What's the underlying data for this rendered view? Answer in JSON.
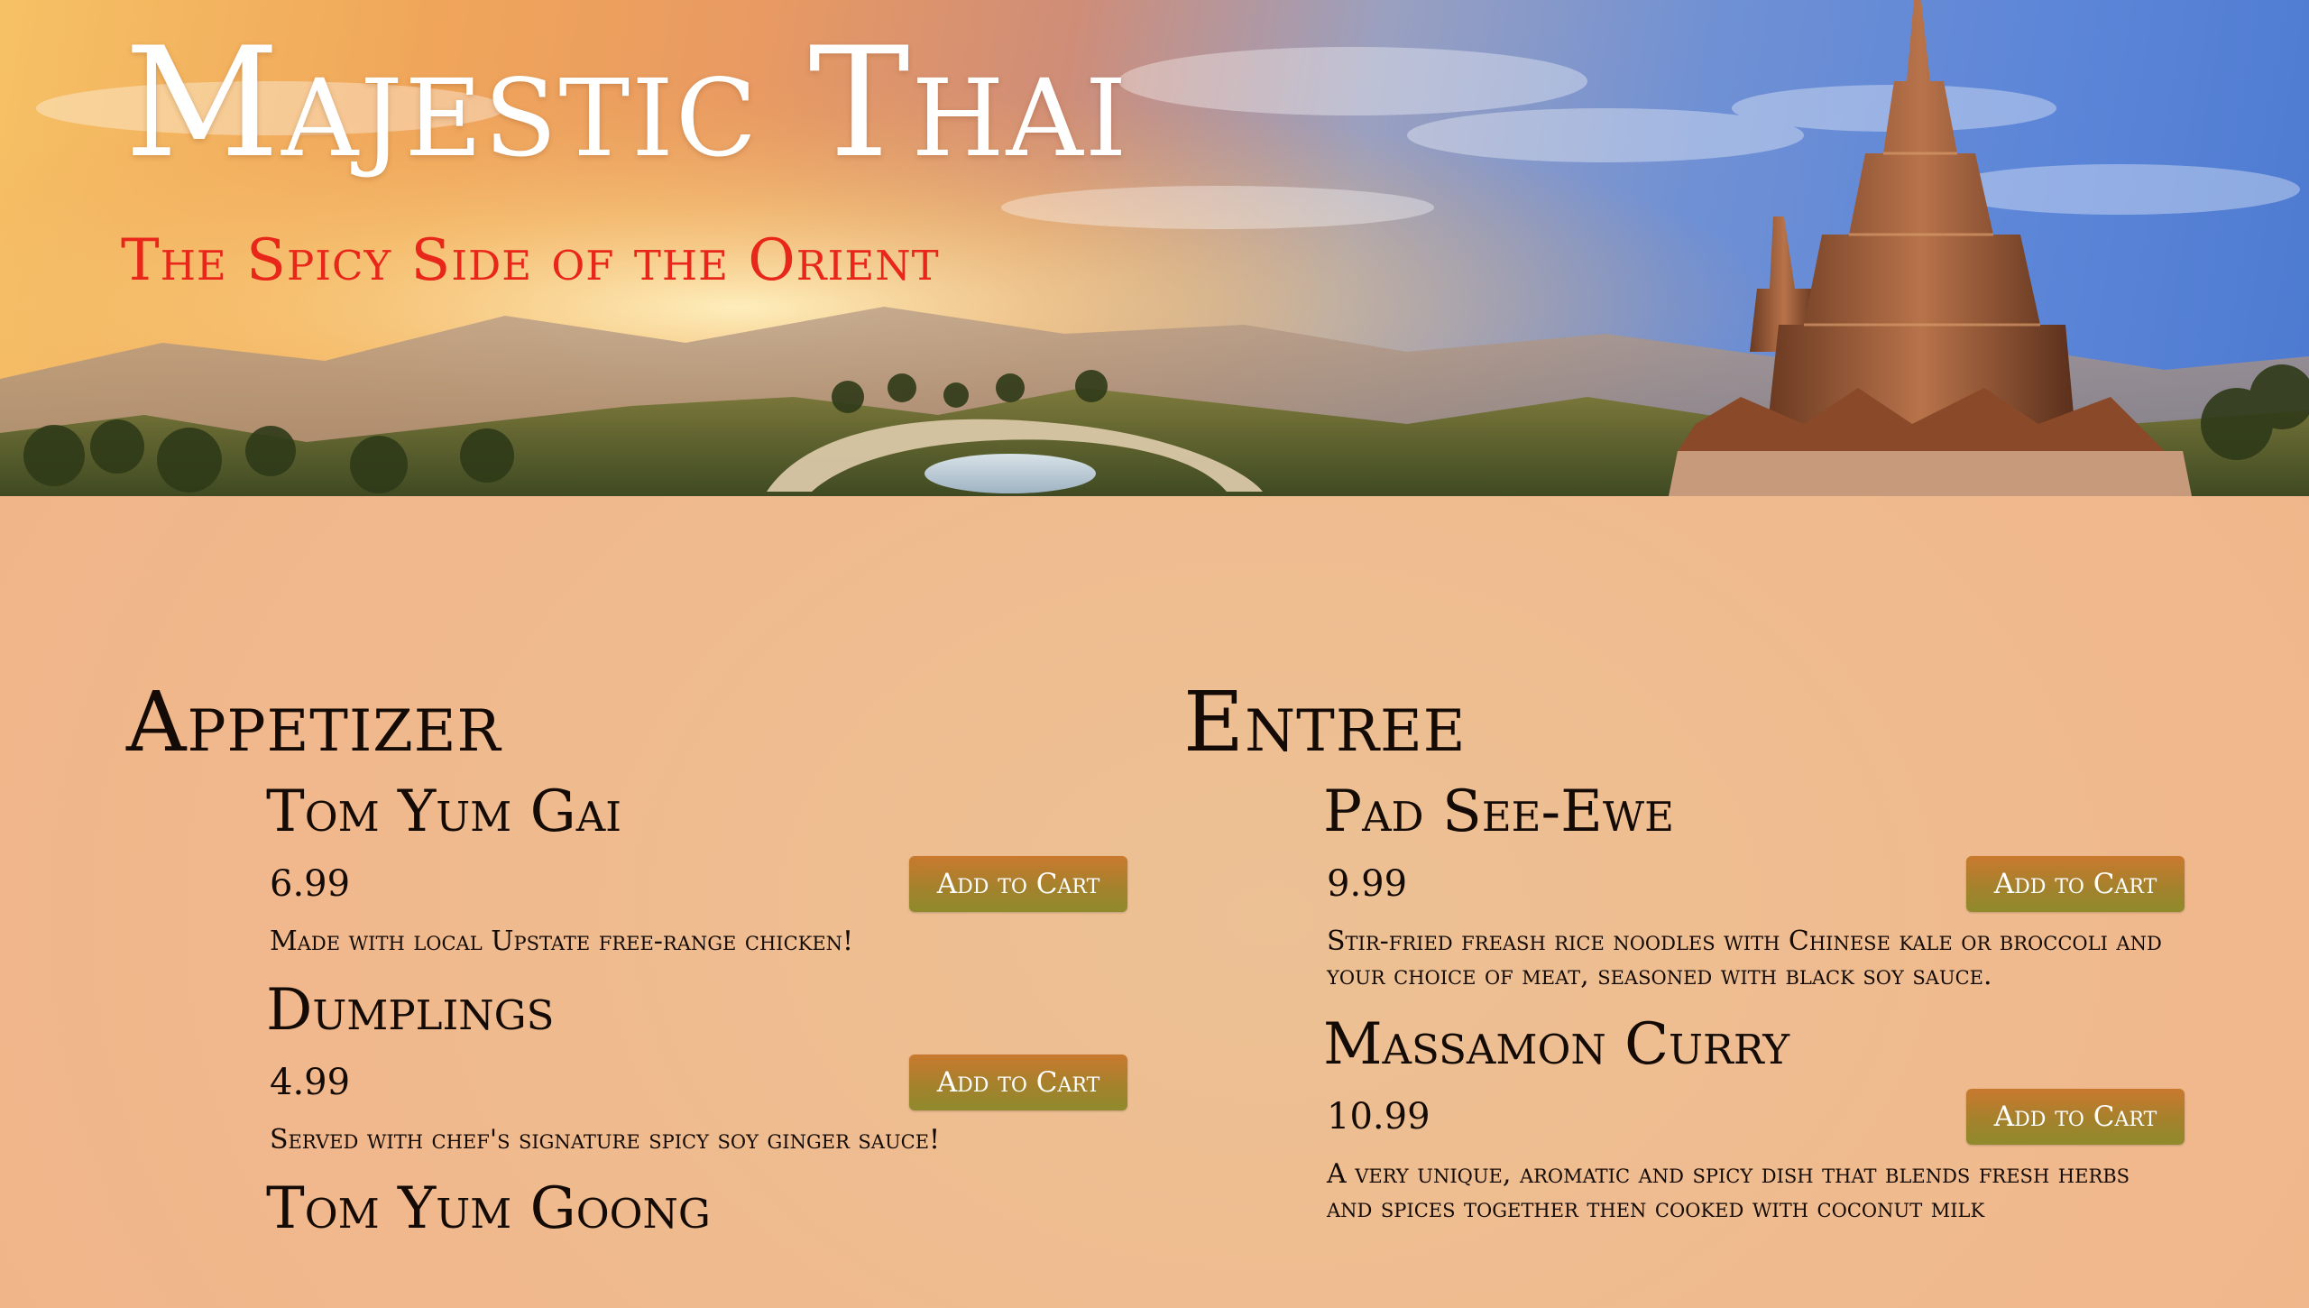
{
  "header": {
    "title": "Majestic Thai",
    "tagline": "The Spicy Side of the Orient"
  },
  "colors": {
    "tagline": "#e8261a",
    "cart_button": "#a2822c",
    "page_background": "#f0b88c",
    "text": "#140b06"
  },
  "sections": [
    {
      "title": "Appetizer",
      "items": [
        {
          "name": "Tom Yum Gai",
          "price": "6.99",
          "button_label": "Add to Cart",
          "description": "Made with local Upstate free-range chicken!"
        },
        {
          "name": "Dumplings",
          "price": "4.99",
          "button_label": "Add to Cart",
          "description": "Served with chef's signature spicy soy ginger sauce!"
        },
        {
          "name": "Tom Yum Goong",
          "price": "",
          "button_label": "",
          "description": ""
        }
      ]
    },
    {
      "title": "Entree",
      "items": [
        {
          "name": "Pad See-Ewe",
          "price": "9.99",
          "button_label": "Add to Cart",
          "description": "Stir-fried freash rice noodles with Chinese kale or broccoli and your choice of meat, seasoned with black soy sauce."
        },
        {
          "name": "Massamon Curry",
          "price": "10.99",
          "button_label": "Add to Cart",
          "description": "A very unique, aromatic and spicy dish that blends fresh herbs and spices together then cooked with coconut milk"
        }
      ]
    }
  ]
}
